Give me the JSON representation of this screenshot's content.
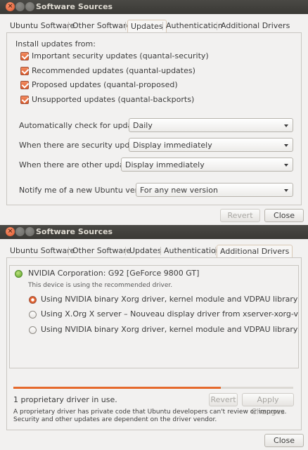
{
  "windows": [
    {
      "title": "Software Sources",
      "tabs": [
        "Ubuntu Software",
        "Other Software",
        "Updates",
        "Authentication",
        "Additional Drivers"
      ],
      "active_tab": "Updates",
      "install_from_label": "Install updates from:",
      "checkboxes": [
        {
          "label": "Important security updates (quantal-security)",
          "checked": true
        },
        {
          "label": "Recommended updates (quantal-updates)",
          "checked": true
        },
        {
          "label": "Proposed updates (quantal-proposed)",
          "checked": true
        },
        {
          "label": "Unsupported updates (quantal-backports)",
          "checked": true
        }
      ],
      "settings": [
        {
          "label": "Automatically check for updates:",
          "value": "Daily"
        },
        {
          "label": "When there are security updates:",
          "value": "Display immediately"
        },
        {
          "label": "When there are other updates:",
          "value": "Display immediately"
        },
        {
          "label": "Notify me of a new Ubuntu version:",
          "value": "For any new version"
        }
      ],
      "buttons": {
        "revert": "Revert",
        "close": "Close"
      }
    },
    {
      "title": "Software Sources",
      "tabs": [
        "Ubuntu Software",
        "Other Software",
        "Updates",
        "Authentication",
        "Additional Drivers"
      ],
      "active_tab": "Additional Drivers",
      "device": {
        "name": "NVIDIA Corporation: G92 [GeForce 9800 GT]",
        "status": "This device is using the recommended driver."
      },
      "drivers": [
        {
          "label": "Using NVIDIA binary Xorg driver, kernel module and VDPAU library from nvidia-",
          "selected": true
        },
        {
          "label": "Using X.Org X server – Nouveau display driver from xserver-xorg-video-nouveau",
          "selected": false
        },
        {
          "label": "Using NVIDIA binary Xorg driver, kernel module and VDPAU library from nvidia-",
          "selected": false
        }
      ],
      "progress_fraction": 0.74,
      "driver_count_text": "1 proprietary driver in use.",
      "note": "A proprietary driver has private code that Ubuntu developers can't review or improve. Security and other updates are dependent on the driver vendor.",
      "buttons": {
        "revert": "Revert",
        "apply": "Apply Changes",
        "close": "Close"
      }
    }
  ]
}
